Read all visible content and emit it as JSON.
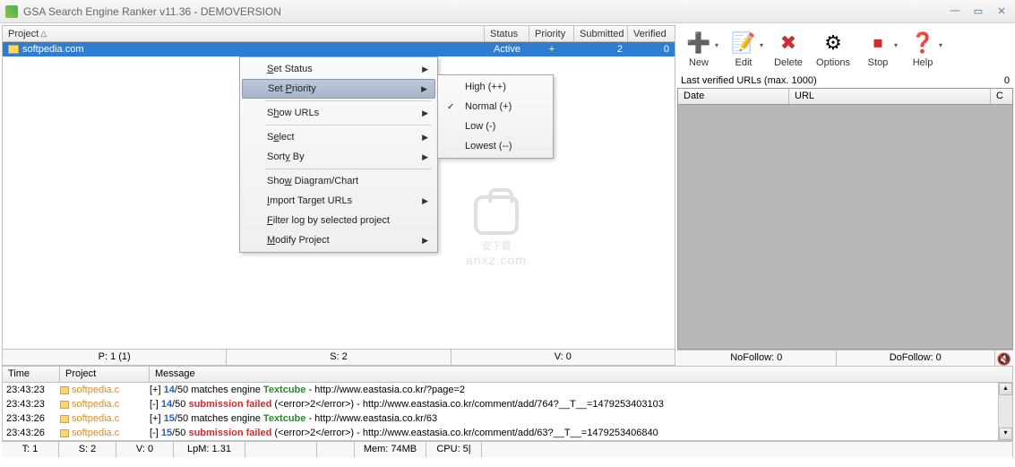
{
  "title": "GSA Search Engine Ranker v11.36 - DEMOVERSION",
  "projHeader": {
    "project": "Project",
    "status": "Status",
    "priority": "Priority",
    "submitted": "Submitted",
    "verified": "Verified"
  },
  "projRow": {
    "name": "softpedia.com",
    "status": "Active",
    "priority": "+",
    "submitted": "2",
    "verified": "0"
  },
  "ctx": {
    "setStatus": "Set Status",
    "setPriority": "Set Priority",
    "showUrls": "Show URLs",
    "select": "Select",
    "sortBy": "Sorty By",
    "showDiagram": "Show Diagram/Chart",
    "importTarget": "Import Target URLs",
    "filterLog": "Filter log by selected project",
    "modify": "Modify Project"
  },
  "sub": {
    "high": "High (++)",
    "normal": "Normal (+)",
    "low": "Low (-)",
    "lowest": "Lowest (--)"
  },
  "leftStats": {
    "p": "P: 1 (1)",
    "s": "S: 2",
    "v": "V: 0"
  },
  "toolbar": {
    "new": "New",
    "edit": "Edit",
    "delete": "Delete",
    "options": "Options",
    "stop": "Stop",
    "help": "Help"
  },
  "verified": {
    "label": "Last verified URLs (max. 1000)",
    "count": "0"
  },
  "urlHeader": {
    "date": "Date",
    "url": "URL",
    "c": "C"
  },
  "rightStats": {
    "nofollow": "NoFollow:  0",
    "dofollow": "DoFollow:  0"
  },
  "logHeader": {
    "time": "Time",
    "project": "Project",
    "message": "Message"
  },
  "log": [
    {
      "time": "23:43:23",
      "project": "softpedia.c",
      "sign": "[+] ",
      "a": "14",
      "b": "/50 matches engine ",
      "engine": "Textcube",
      "rest": " - http://www.eastasia.co.kr/?page=2",
      "ok": true
    },
    {
      "time": "23:43:23",
      "project": "softpedia.c",
      "sign": "[-] ",
      "a": "14",
      "b": "/50 ",
      "engine": "submission failed",
      "rest": " (<error>2</error>) - http://www.eastasia.co.kr/comment/add/764?__T__=1479253403103",
      "ok": false
    },
    {
      "time": "23:43:26",
      "project": "softpedia.c",
      "sign": "[+] ",
      "a": "15",
      "b": "/50 matches engine ",
      "engine": "Textcube",
      "rest": " - http://www.eastasia.co.kr/63",
      "ok": true
    },
    {
      "time": "23:43:26",
      "project": "softpedia.c",
      "sign": "[-] ",
      "a": "15",
      "b": "/50 ",
      "engine": "submission failed",
      "rest": " (<error>2</error>) - http://www.eastasia.co.kr/comment/add/63?__T__=1479253406840",
      "ok": false
    }
  ],
  "status": {
    "t": "T: 1",
    "s": "S: 2",
    "v": "V: 0",
    "lpm": "LpM: 1.31",
    "mem": "Mem: 74MB",
    "cpu": "CPU: 5|"
  },
  "watermark": {
    "main": "安下载",
    "sub": "anxz.com"
  }
}
